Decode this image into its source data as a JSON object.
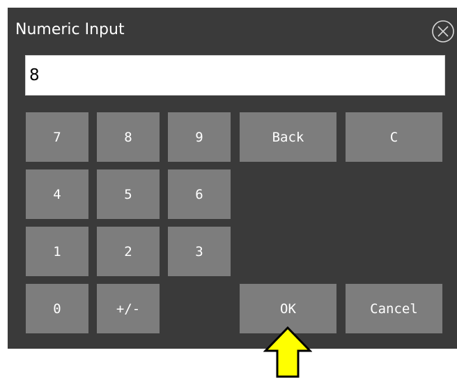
{
  "dialog": {
    "title": "Numeric Input",
    "display_value": "8",
    "close_icon": "circle-x-icon"
  },
  "keypad": {
    "k7": "7",
    "k8": "8",
    "k9": "9",
    "back": "Back",
    "clear": "C",
    "k4": "4",
    "k5": "5",
    "k6": "6",
    "k1": "1",
    "k2": "2",
    "k3": "3",
    "k0": "0",
    "plus_minus": "+/-",
    "ok": "OK",
    "cancel": "Cancel"
  },
  "annotation": {
    "pointer_icon": "yellow-up-arrow-icon",
    "pointer_color": "#ffff00"
  },
  "colors": {
    "dialog_bg": "#3a3a3a",
    "key_bg": "#7d7d7d",
    "text": "#ffffff"
  }
}
